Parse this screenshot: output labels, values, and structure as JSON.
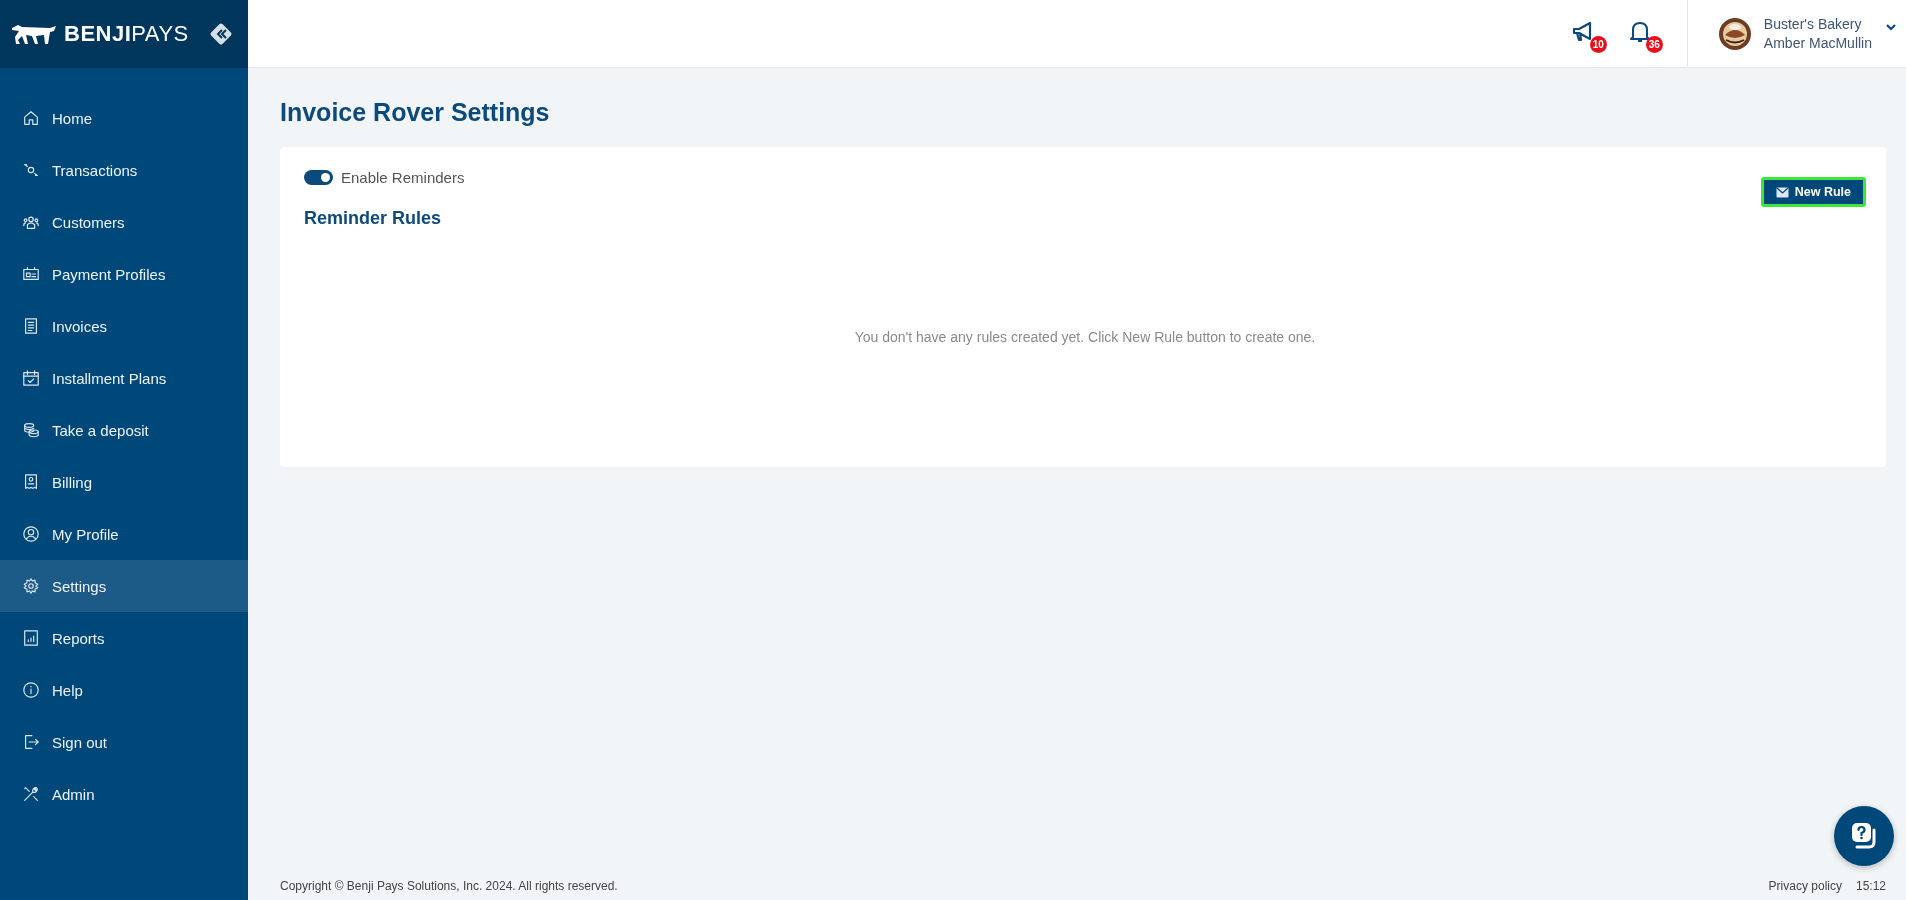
{
  "sidebar": {
    "logo": {
      "bold": "BENJI",
      "light": "PAYS"
    },
    "items": [
      {
        "label": "Home",
        "selected": false
      },
      {
        "label": "Transactions",
        "selected": false
      },
      {
        "label": "Customers",
        "selected": false
      },
      {
        "label": "Payment Profiles",
        "selected": false
      },
      {
        "label": "Invoices",
        "selected": false
      },
      {
        "label": "Installment Plans",
        "selected": false
      },
      {
        "label": "Take a deposit",
        "selected": false
      },
      {
        "label": "Billing",
        "selected": false
      },
      {
        "label": "My Profile",
        "selected": false
      },
      {
        "label": "Settings",
        "selected": true
      },
      {
        "label": "Reports",
        "selected": false
      },
      {
        "label": "Help",
        "selected": false
      },
      {
        "label": "Sign out",
        "selected": false
      },
      {
        "label": "Admin",
        "selected": false
      }
    ]
  },
  "header": {
    "announcements_count": "10",
    "notifications_count": "36",
    "business_name": "Buster's Bakery",
    "user_name": "Amber MacMullin"
  },
  "page": {
    "title": "Invoice Rover Settings",
    "enable_reminders": {
      "label": "Enable Reminders",
      "on": true
    },
    "new_rule_button": "New Rule",
    "section_title": "Reminder Rules",
    "empty_message": "You don't have any rules created yet. Click New Rule button to create one."
  },
  "footer": {
    "copyright": "Copyright © Benji Pays Solutions, Inc. 2024. All rights reserved.",
    "privacy_link": "Privacy policy",
    "time": "15:12"
  }
}
